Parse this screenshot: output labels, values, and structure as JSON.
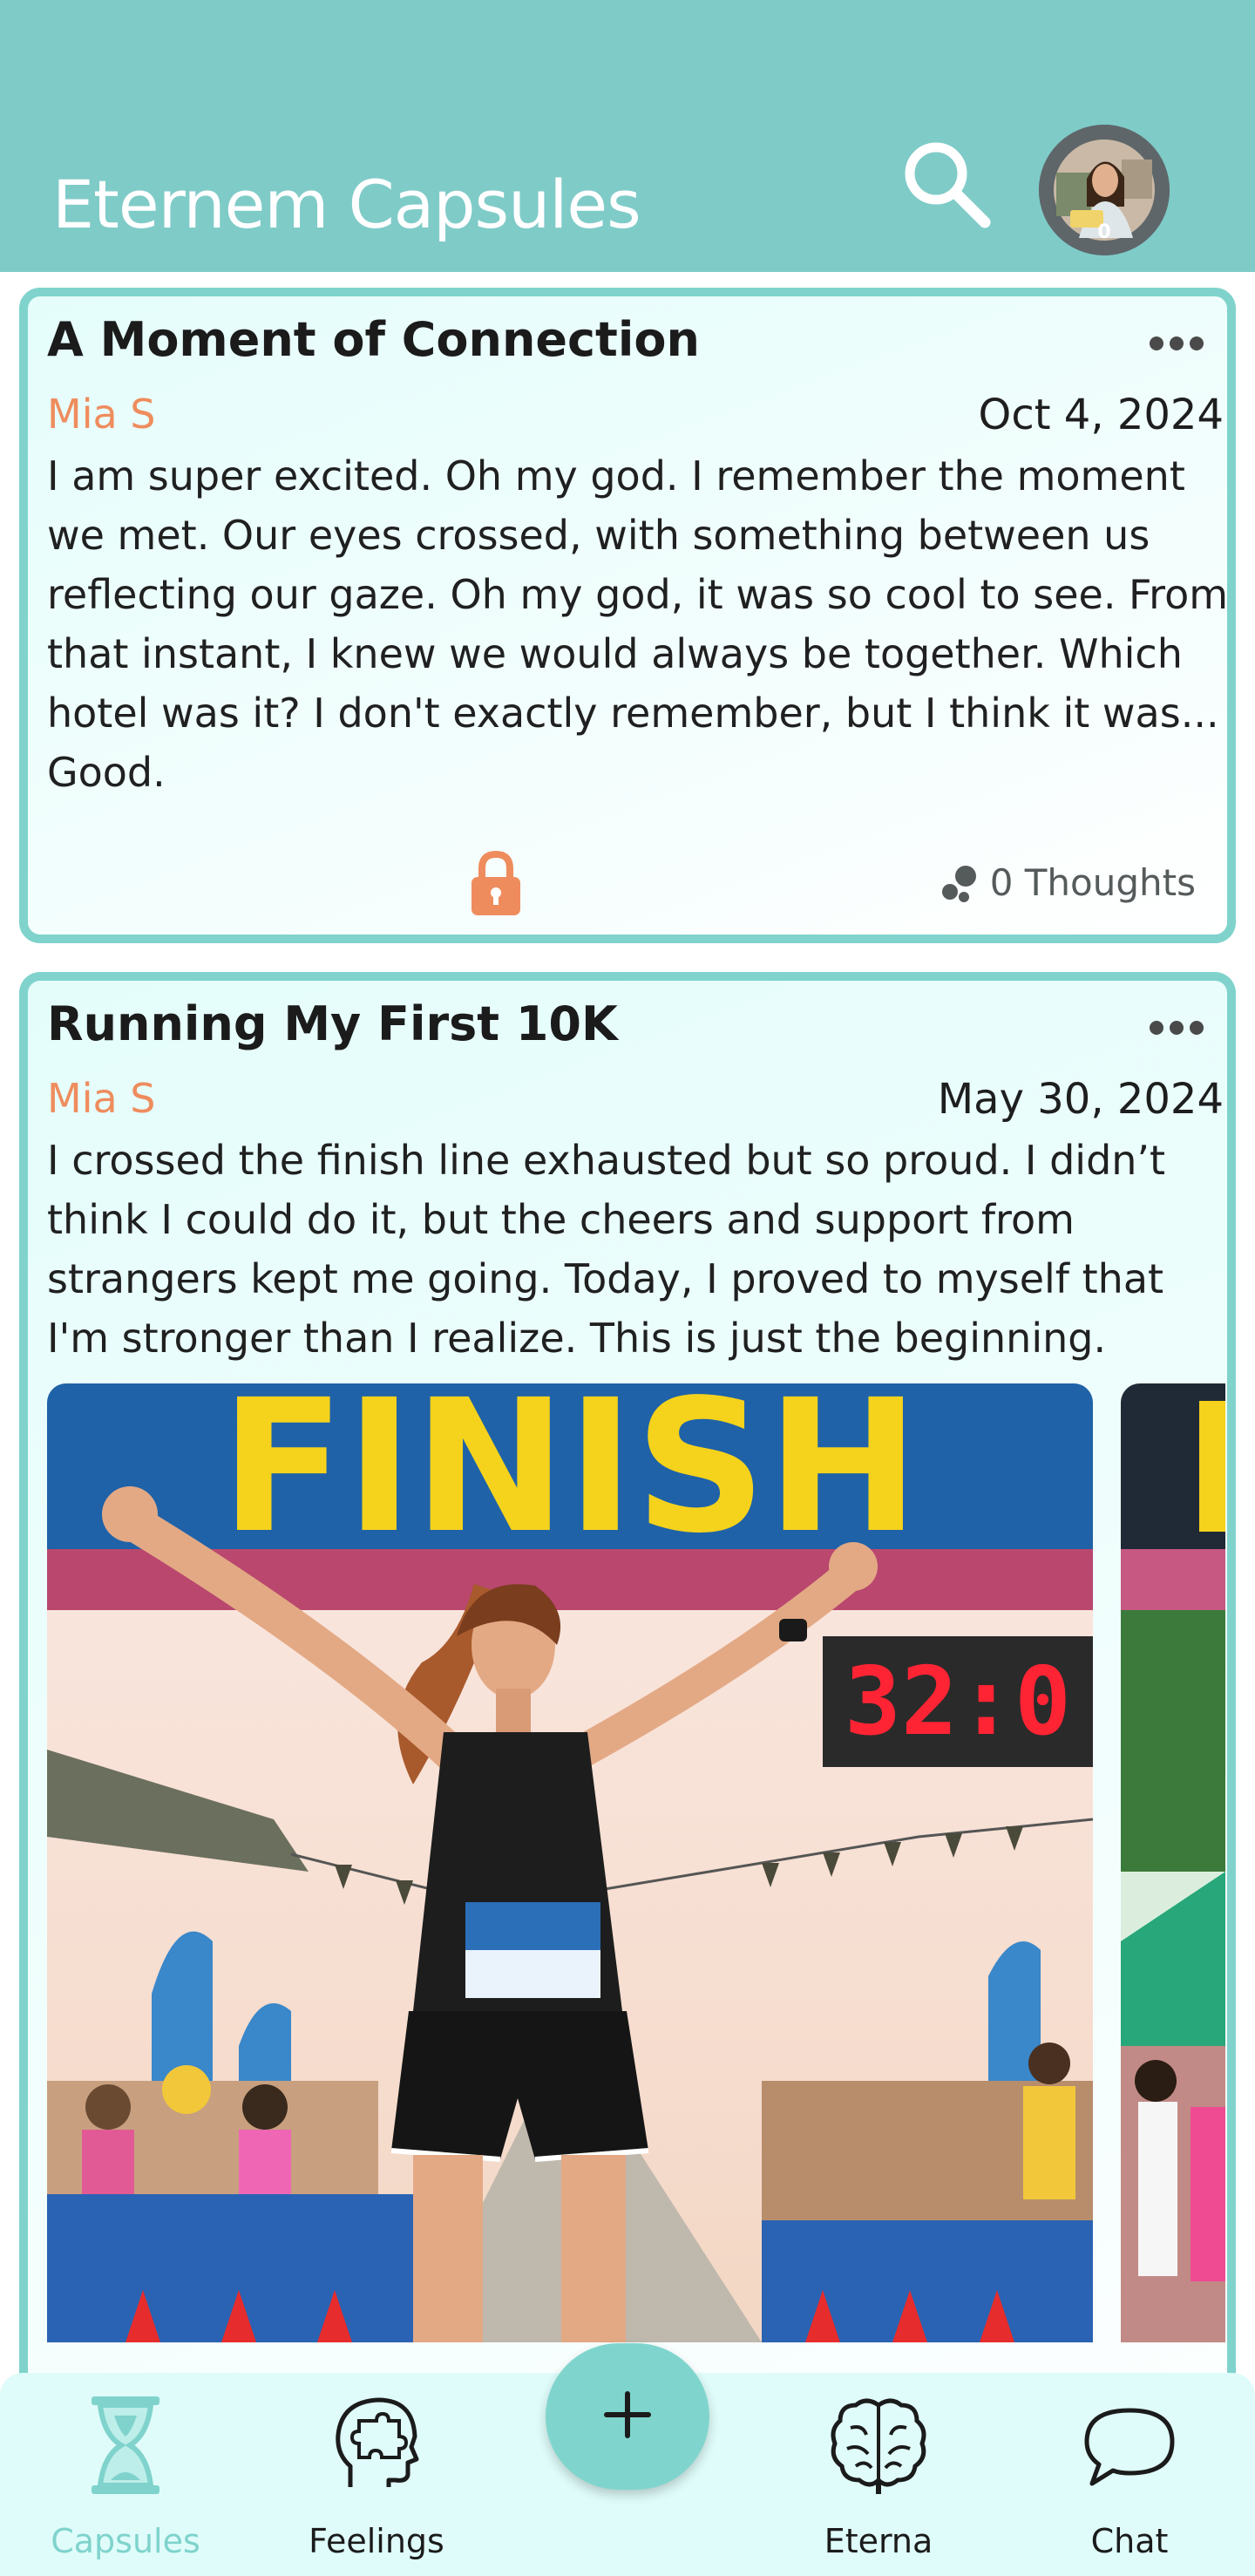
{
  "header": {
    "title": "Eternem Capsules"
  },
  "avatar": {
    "badge": "0"
  },
  "capsules": [
    {
      "title": "A Moment of Connection",
      "author": "Mia S",
      "date": "Oct 4, 2024",
      "body": "I am super excited. Oh my god. I remember the moment we met. Our eyes crossed, with something between us reflecting our gaze. Oh my god, it was so cool to see. From that instant, I knew we would always be together. Which hotel was it? I don't exactly remember, but I think it was... Good.",
      "thoughts": "0 Thoughts"
    },
    {
      "title": "Running My First 10K",
      "author": "Mia S",
      "date": "May 30, 2024",
      "body": "I crossed the finish line exhausted but so proud. I didn’t think I could do it, but the cheers and support from strangers kept me going. Today, I proved to myself that I'm stronger than I realize. This is just the beginning.",
      "image": {
        "banner_text": "FINISH",
        "clock_text": "32:0"
      }
    }
  ],
  "nav": {
    "items": [
      {
        "label": "Capsules",
        "icon": "hourglass-icon",
        "active": true
      },
      {
        "label": "Feelings",
        "icon": "head-puzzle-icon",
        "active": false
      },
      {
        "label": "Eterna",
        "icon": "brain-icon",
        "active": false
      },
      {
        "label": "Chat",
        "icon": "chat-bubble-icon",
        "active": false
      }
    ],
    "fab_icon": "plus-icon"
  },
  "colors": {
    "header": "#7fcbc8",
    "accent": "#7fd3cc",
    "author": "#ef8c5d",
    "lock": "#ef8c5d"
  }
}
